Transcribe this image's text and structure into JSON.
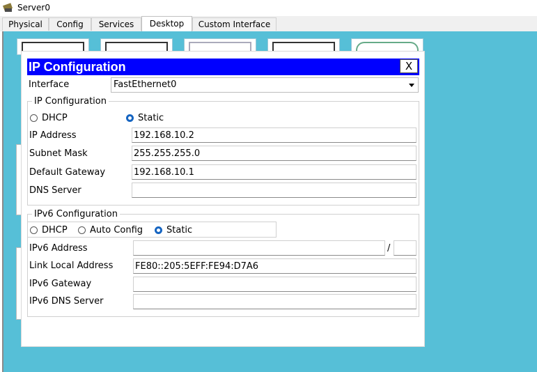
{
  "window": {
    "title": "Server0"
  },
  "tabs": [
    {
      "label": "Physical"
    },
    {
      "label": "Config"
    },
    {
      "label": "Services"
    },
    {
      "label": "Desktop"
    },
    {
      "label": "Custom Interface"
    }
  ],
  "active_tab": "Desktop",
  "dialog": {
    "title": "IP Configuration",
    "close_label": "X",
    "interface_label": "Interface",
    "interface_value": "FastEthernet0",
    "ipv4": {
      "group_title": "IP Configuration",
      "dhcp_label": "DHCP",
      "static_label": "Static",
      "selected": "Static",
      "ip_address_label": "IP Address",
      "ip_address_value": "192.168.10.2",
      "subnet_mask_label": "Subnet Mask",
      "subnet_mask_value": "255.255.255.0",
      "gateway_label": "Default Gateway",
      "gateway_value": "192.168.10.1",
      "dns_label": "DNS Server",
      "dns_value": ""
    },
    "ipv6": {
      "group_title": "IPv6 Configuration",
      "dhcp_label": "DHCP",
      "auto_label": "Auto Config",
      "static_label": "Static",
      "selected": "Static",
      "address_label": "IPv6 Address",
      "address_value": "",
      "prefix_separator": "/",
      "prefix_value": "",
      "link_local_label": "Link Local Address",
      "link_local_value": "FE80::205:5EFF:FE94:D7A6",
      "gateway_label": "IPv6 Gateway",
      "gateway_value": "",
      "dns_label": "IPv6 DNS Server",
      "dns_value": ""
    }
  },
  "colors": {
    "desktop_bg": "#56bfd7",
    "dialog_header": "#0000ff",
    "radio_accent": "#1665c1"
  }
}
